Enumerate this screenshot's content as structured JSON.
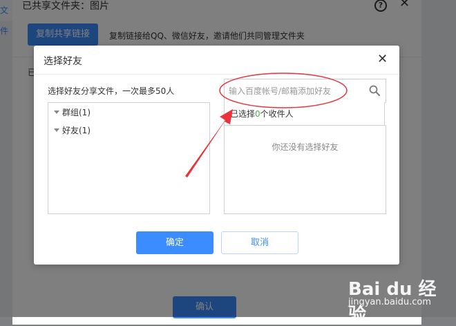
{
  "background": {
    "tab_label": "文件",
    "dialog_title": "已共享文件夹：图片",
    "help_icon": "question-circle-icon",
    "copy_link_button": "复制共享链接",
    "copy_link_desc": "复制链接给QQ、微信好友，邀请他们共同管理文件夹",
    "row_text": "已",
    "confirm_button": "确认"
  },
  "modal": {
    "title": "选择好友",
    "close_icon": "close-icon",
    "left": {
      "hint": "选择好友分享文件，一次最多50人",
      "tree": [
        {
          "label": "群组(1)"
        },
        {
          "label": "好友(1)"
        }
      ]
    },
    "right": {
      "search_placeholder": "输入百度帐号/邮箱添加好友",
      "search_icon": "search-icon",
      "selected_prefix": "已选择",
      "selected_count": "0",
      "selected_suffix": "个收件人",
      "empty_text": "你还没有选择好友"
    },
    "ok_button": "确定",
    "cancel_button": "取消"
  },
  "colors": {
    "accent": "#3b8cff",
    "annotation": "#e8343a",
    "count_green": "#4caf50"
  },
  "watermark": {
    "logo_text": "Bai du 经验",
    "site": "jingyan.baidu.com"
  }
}
